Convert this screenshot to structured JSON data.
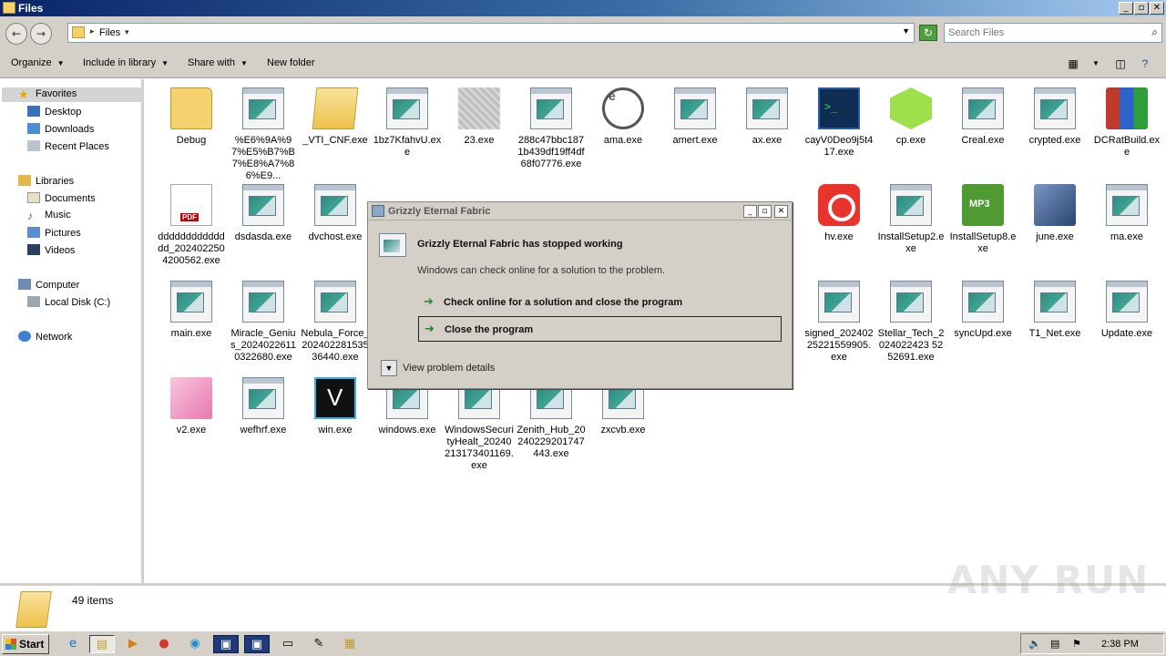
{
  "window": {
    "title": "Files"
  },
  "address": {
    "path": "Files",
    "search_placeholder": "Search Files"
  },
  "toolbar": {
    "organize": "Organize",
    "include_in_library": "Include in library",
    "share_with": "Share with",
    "new_folder": "New folder"
  },
  "sidebar": {
    "favorites": "Favorites",
    "desktop": "Desktop",
    "downloads": "Downloads",
    "recent_places": "Recent Places",
    "libraries": "Libraries",
    "documents": "Documents",
    "music": "Music",
    "pictures": "Pictures",
    "videos": "Videos",
    "computer": "Computer",
    "local_disk": "Local Disk (C:)",
    "network": "Network"
  },
  "files": [
    {
      "name": "Debug",
      "icon": "folder-icon"
    },
    {
      "name": "%E6%9A%97%E5%B7%B7%E8%A7%86%E9...",
      "icon": "exe-icon"
    },
    {
      "name": "_VTI_CNF.exe",
      "icon": "folder-exe-icon"
    },
    {
      "name": "1bz7KfahvU.exe",
      "icon": "exe-icon"
    },
    {
      "name": "23.exe",
      "icon": "blurred-icon"
    },
    {
      "name": "288c47bbc1871b439df19ff4df68f07776.exe",
      "icon": "exe-icon"
    },
    {
      "name": "ama.exe",
      "icon": "gauge-icon"
    },
    {
      "name": "amert.exe",
      "icon": "exe-icon"
    },
    {
      "name": "ax.exe",
      "icon": "exe-icon"
    },
    {
      "name": "cayV0Deo9j5t417.exe",
      "icon": "console-icon"
    },
    {
      "name": "cp.exe",
      "icon": "cube-icon"
    },
    {
      "name": "Creal.exe",
      "icon": "exe-icon"
    },
    {
      "name": "crypted.exe",
      "icon": "exe-icon"
    },
    {
      "name": "DCRatBuild.exe",
      "icon": "rar-icon"
    },
    {
      "name": "dddddddddddddd_2024022504200562.exe",
      "icon": "pdf-icon"
    },
    {
      "name": "dsdasda.exe",
      "icon": "exe-icon"
    },
    {
      "name": "dvchost.exe",
      "icon": "exe-icon"
    },
    {
      "name": "hv.exe",
      "icon": "gom-player-icon"
    },
    {
      "name": "InstallSetup2.exe",
      "icon": "exe-icon"
    },
    {
      "name": "InstallSetup8.exe",
      "icon": "amazon-mp3-icon"
    },
    {
      "name": "june.exe",
      "icon": "installer-icon"
    },
    {
      "name": "ma.exe",
      "icon": "exe-icon"
    },
    {
      "name": "main.exe",
      "icon": "exe-icon"
    },
    {
      "name": "Miracle_Genius_20240226110322680.exe",
      "icon": "exe-icon"
    },
    {
      "name": "Nebula_Force_20240228153536440.exe",
      "icon": "exe-icon"
    },
    {
      "name": "signed_20240225221559905.exe",
      "icon": "exe-icon"
    },
    {
      "name": "Stellar_Tech_2024022423 5252691.exe",
      "icon": "exe-icon"
    },
    {
      "name": "syncUpd.exe",
      "icon": "exe-icon"
    },
    {
      "name": "T1_Net.exe",
      "icon": "exe-icon"
    },
    {
      "name": "Update.exe",
      "icon": "exe-icon"
    },
    {
      "name": "v2.exe",
      "icon": "pink-box-icon"
    },
    {
      "name": "wefhrf.exe",
      "icon": "exe-icon"
    },
    {
      "name": "win.exe",
      "icon": "v-logo-icon"
    },
    {
      "name": "windows.exe",
      "icon": "exe-icon"
    },
    {
      "name": "WindowsSecurityHealt_20240213173401169.exe",
      "icon": "exe-icon"
    },
    {
      "name": "Zenith_Hub_20240229201747443.exe",
      "icon": "exe-icon"
    },
    {
      "name": "zxcvb.exe",
      "icon": "exe-icon"
    }
  ],
  "dialog": {
    "title": "Grizzly Eternal Fabric",
    "heading": "Grizzly Eternal Fabric has stopped working",
    "subtext": "Windows can check online for a solution to the problem.",
    "option_check": "Check online for a solution and close the program",
    "option_close": "Close the program",
    "details": "View problem details"
  },
  "status": {
    "item_count": "49 items"
  },
  "watermark": "ANY RUN",
  "taskbar": {
    "start": "Start",
    "clock": "2:38 PM"
  }
}
